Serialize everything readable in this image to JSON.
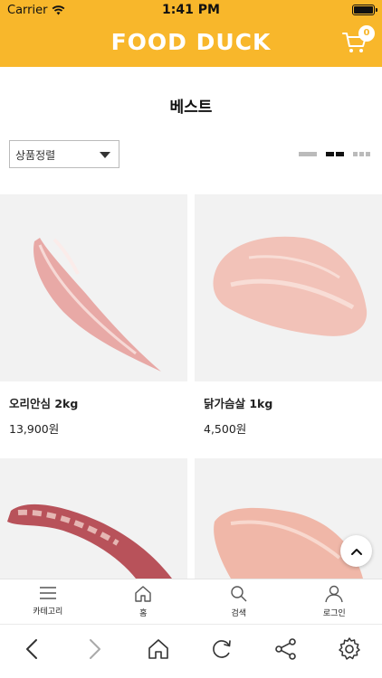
{
  "status_bar": {
    "carrier": "Carrier",
    "time": "1:41 PM"
  },
  "header": {
    "logo": "FOOD DUCK",
    "cart_count": "0"
  },
  "page_title": "베스트",
  "sort": {
    "label": "상품정렬"
  },
  "products": [
    {
      "name": "오리안심 2kg",
      "price": "13,900원"
    },
    {
      "name": "닭가슴살 1kg",
      "price": "4,500원"
    },
    {
      "name": "",
      "price": ""
    },
    {
      "name": "",
      "price": ""
    }
  ],
  "bottom_nav": [
    {
      "label": "카테고리"
    },
    {
      "label": "홈"
    },
    {
      "label": "검색"
    },
    {
      "label": "로그인"
    }
  ],
  "colors": {
    "brand": "#f8b72b",
    "meat_duck": "#e8a9a6",
    "meat_chicken": "#f2c2b8"
  }
}
